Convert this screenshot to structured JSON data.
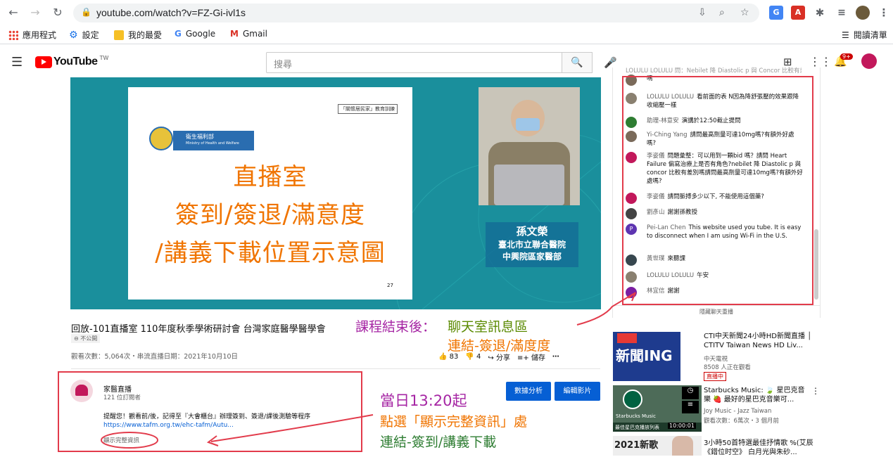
{
  "browser": {
    "url": "youtube.com/watch?v=FZ-Gi-ivl1s",
    "bookmarks": [
      "應用程式",
      "設定",
      "我的最愛",
      "Google",
      "Gmail"
    ],
    "reading_list": "閱讀清單",
    "notification_count": "9+"
  },
  "youtube": {
    "logo_text": "YouTube",
    "logo_suffix": "TW",
    "search_placeholder": "搜尋"
  },
  "video": {
    "slide_header": "「關懷居民家」教育訓練",
    "ministry_name": "衛生福利部",
    "ministry_en": "Ministry of Health and Welfare",
    "slide_lines": [
      "直播室",
      "簽到/簽退/滿意度",
      "/講義下載位置示意圖"
    ],
    "page_number": "27",
    "speaker_name": "孫文榮",
    "speaker_affil_1": "臺北市立聯合醫院",
    "speaker_affil_2": "中興院區家醫部",
    "title": "回放-101直播室 110年度秋季學術研討會 台灣家庭醫學醫學會",
    "unlisted": "不公開",
    "views": "觀看次數：5,064次・串流直播日期：2021年10月10日",
    "likes": "83",
    "dislikes": "4",
    "share": "分享",
    "save": "儲存"
  },
  "channel": {
    "name": "家醫直播",
    "subscribers": "121 位訂閱者",
    "analytics_btn": "數據分析",
    "edit_btn": "編輯影片",
    "description": "提醒您！觀看前/後，記得至『大會櫃台』辦理簽到、簽退/課後測驗等程序",
    "link": "https://www.tafm.org.tw/ehc-tafm/Autu...",
    "show_more": "顯示完整資訊"
  },
  "chat": {
    "top_partial": "LOLULU LOLULU 問：Nebilet 降 Diastolic p 與 Concor 比較有差別嗎",
    "messages": [
      {
        "author": "",
        "text": "嗎",
        "color": "#7a6a5a"
      },
      {
        "author": "LOLULU LOLULU",
        "text": "看前面的表 N因為降舒張壓的效果跟降收縮壓一樣",
        "color": "#8a8070"
      },
      {
        "author": "助理-林意安",
        "text": "演講於12:50截止提問",
        "color": "#2e7d32"
      },
      {
        "author": "Yi-Ching Yang",
        "text": "請問最高劑量可達10mg嗎?有額外好處嗎?",
        "color": "#7a6a5a"
      },
      {
        "author": "李姿儀",
        "text": "問題彙整：可以用到一顆bid 嗎？請問 Heart Failure 偏寫治療上是否有角色?nebilet 降 Diastolic p 與 concor 比較有差別嗎請問最高劑量可達10mg嗎?有額外好處嗎?",
        "color": "#c2185b"
      },
      {
        "author": "李姿儀",
        "text": "請問脈搏多少以下, 不能使用這個藥?",
        "color": "#c2185b"
      },
      {
        "author": "劉彥山",
        "text": "謝謝孫教授",
        "color": "#444"
      },
      {
        "author": "Pei-Lan Chen",
        "text": "This website used you tube. It is easy to disconnect when I am using Wi-Fi in the U.S.",
        "color": "#5e35b1",
        "initial": "P"
      },
      {
        "author": "黃世璞",
        "text": "來聽課",
        "color": "#37474f"
      },
      {
        "author": "LOLULU LOLULU",
        "text": "午安",
        "color": "#8a8070"
      },
      {
        "author": "林宜信",
        "text": "謝謝",
        "color": "#7b1fa2"
      }
    ],
    "hide_chat": "隱藏聊天重播"
  },
  "annotations": {
    "chat_area_1": "課程結束後：",
    "chat_area_2": "聊天室訊息區",
    "chat_area_3": "連結-簽退/滿度度",
    "show_more_1": "當日13:20起",
    "show_more_2": "點選「顯示完整資訊」處",
    "show_more_3": "連結-簽到/講義下載"
  },
  "recommendations": [
    {
      "title": "CTI中天新聞24小時HD新聞直播 │ CTITV Taiwan News HD Liv...",
      "channel": "中天電視",
      "meta": "8508 人正在觀看",
      "badge": "直播中",
      "thumb_text": "新聞ING"
    },
    {
      "title": "Starbucks Music: 🍃 星巴克音樂 🍓 最好的星巴克音樂可...",
      "channel": "Joy Music - Jazz Taiwan",
      "meta": "觀看次數：6萬次・3 個月前",
      "duration": "10:00:01",
      "thumb_text": "Starbucks Music",
      "thumb_sub": "最佳星巴克播放列表"
    },
    {
      "title": "3小時50首特選最佳抒情歌 %(艾辰《錯位时空》 白月光與朱砂...",
      "thumb_text": "2021新歌"
    }
  ]
}
